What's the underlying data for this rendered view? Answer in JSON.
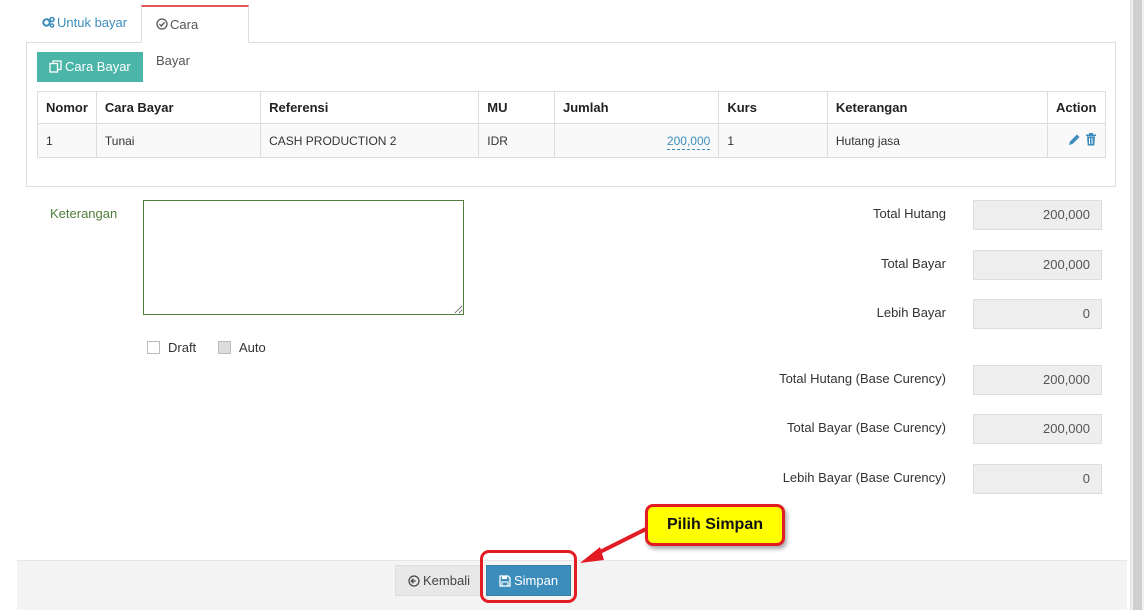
{
  "tabs": [
    {
      "label": "Untuk bayar",
      "icon": "gears-icon"
    },
    {
      "label": "Cara Bayar",
      "icon": "check-circle-icon"
    }
  ],
  "panel": {
    "add_button_label": "Cara Bayar",
    "columns": [
      "Nomor",
      "Cara Bayar",
      "Referensi",
      "MU",
      "Jumlah",
      "Kurs",
      "Keterangan",
      "Action"
    ],
    "rows": [
      {
        "nomor": "1",
        "cara_bayar": "Tunai",
        "referensi": "CASH PRODUCTION 2",
        "mu": "IDR",
        "jumlah": "200,000",
        "kurs": "1",
        "keterangan": "Hutang jasa"
      }
    ]
  },
  "form": {
    "keterangan_label": "Keterangan",
    "keterangan_value": "",
    "draft_label": "Draft",
    "auto_label": "Auto"
  },
  "summary": [
    {
      "label": "Total Hutang",
      "value": "200,000"
    },
    {
      "label": "Total Bayar",
      "value": "200,000"
    },
    {
      "label": "Lebih Bayar",
      "value": "0"
    },
    {
      "label": "Total Hutang (Base Curency)",
      "value": "200,000"
    },
    {
      "label": "Total Bayar (Base Curency)",
      "value": "200,000"
    },
    {
      "label": "Lebih Bayar (Base Curency)",
      "value": "0"
    }
  ],
  "footer": {
    "back_label": "Kembali",
    "save_label": "Simpan"
  },
  "annotation": {
    "callout_text": "Pilih Simpan"
  },
  "colors": {
    "accent": "#3c8dbc",
    "teal": "#4ab5a8",
    "highlight": "#e31b23",
    "callout_bg": "#ffff00"
  }
}
